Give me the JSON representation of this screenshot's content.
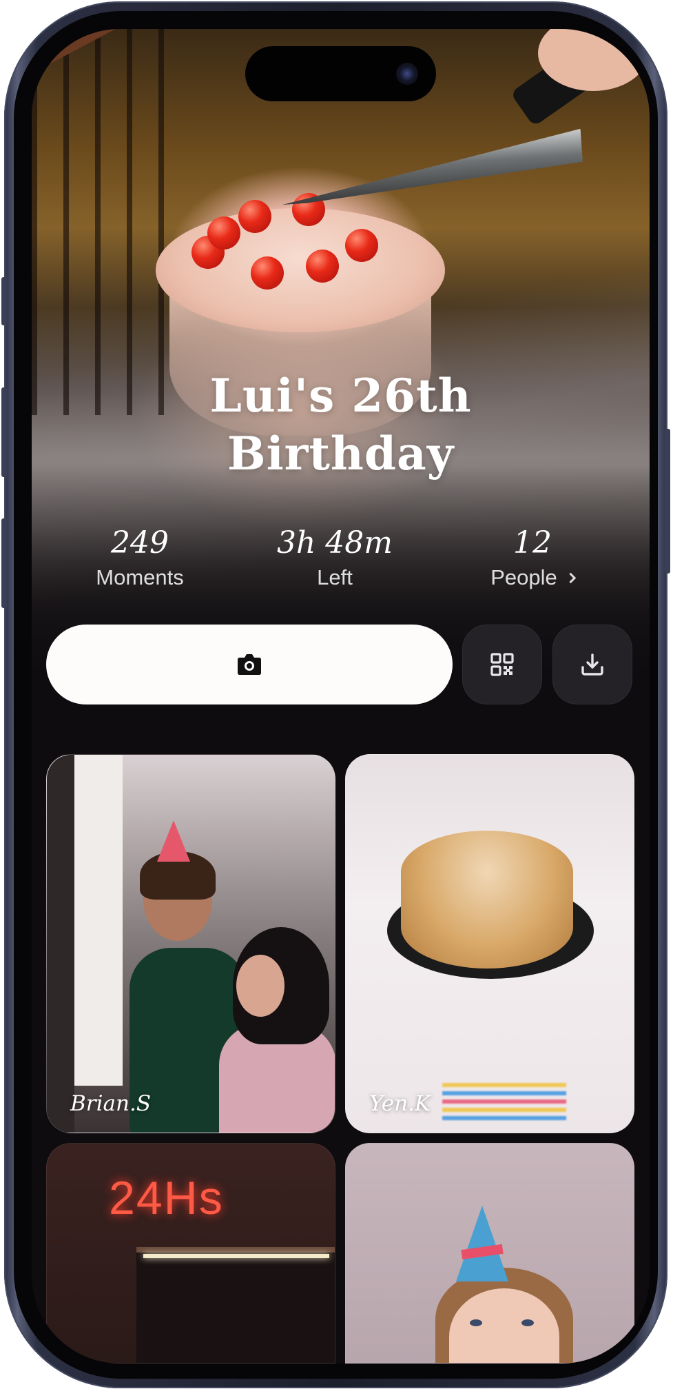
{
  "event": {
    "title_line1": "Lui's 26th",
    "title_line2": "Birthday"
  },
  "stats": [
    {
      "value": "249",
      "label": "Moments"
    },
    {
      "value": "3h 48m",
      "label": "Left"
    },
    {
      "value": "12",
      "label": "People"
    }
  ],
  "actions": {
    "capture_icon": "camera-icon",
    "qr_icon": "qr-code-icon",
    "download_icon": "download-icon"
  },
  "photos": [
    {
      "author": "Brian.S"
    },
    {
      "author": "Yen.K"
    },
    {
      "author": "",
      "sign_text": "24Hs"
    },
    {
      "author": ""
    }
  ],
  "colors": {
    "background": "#0e0c0f",
    "capture_button": "#fdfcfb",
    "square_button": "#242226",
    "text": "#ffffff"
  }
}
